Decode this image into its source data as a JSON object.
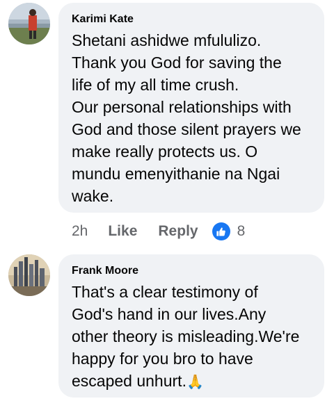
{
  "comments": [
    {
      "author": "Karimi Kate",
      "text": "Shetani ashidwe mfululizo.\nThank you God for saving the\nlife of my all time crush.\nOur personal relationships with\nGod and those silent prayers we\nmake really protects us. O\nmundu emenyithanie na Ngai\nwake.",
      "time": "2h",
      "like_label": "Like",
      "reply_label": "Reply",
      "reaction_icon": "thumbs-up-icon",
      "reaction_count": "8"
    },
    {
      "author": "Frank Moore",
      "text": "That's a clear testimony of\nGod's hand in our lives.Any\nother theory is misleading.We're\nhappy for you bro to have\nescaped unhurt.",
      "emoji": "🙏",
      "emoji_icon": "folded-hands-icon"
    }
  ],
  "colors": {
    "bubble": "#f0f2f5",
    "meta_text": "#65676b",
    "like_badge": "#1877f2"
  }
}
